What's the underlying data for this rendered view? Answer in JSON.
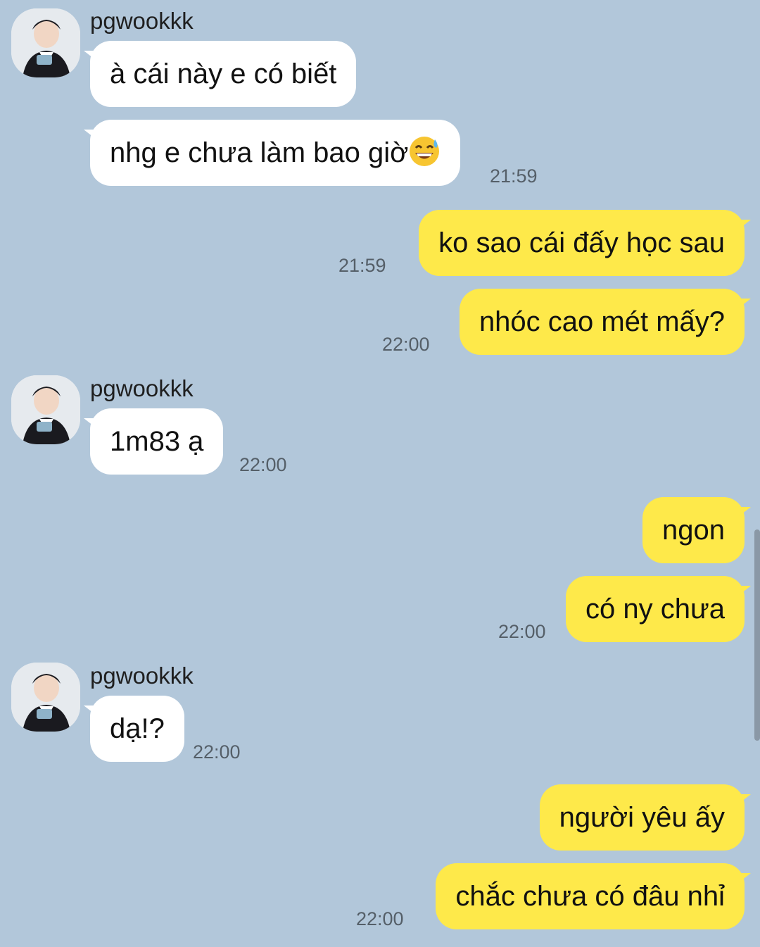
{
  "contact": {
    "name": "pgwookkk"
  },
  "messages": [
    {
      "from": "them",
      "text": "à cái này e có biết",
      "time": ""
    },
    {
      "from": "them",
      "text": "nhg e chưa làm bao giờ",
      "emoji": "grinning-sweat-emoji",
      "time": "21:59"
    },
    {
      "from": "me",
      "text": "ko sao cái đấy học sau",
      "time": "21:59"
    },
    {
      "from": "me",
      "text": "nhóc cao mét mấy?",
      "time": "22:00"
    },
    {
      "from": "them",
      "text": "1m83 ạ",
      "time": "22:00"
    },
    {
      "from": "me",
      "text": "ngon",
      "time": ""
    },
    {
      "from": "me",
      "text": "có ny chưa",
      "time": "22:00"
    },
    {
      "from": "them",
      "text": "dạ!?",
      "time": "22:00"
    },
    {
      "from": "me",
      "text": "người yêu ấy",
      "time": ""
    },
    {
      "from": "me",
      "text": "chắc chưa có đâu nhỉ",
      "time": "22:00"
    }
  ],
  "colors": {
    "background": "#b2c7da",
    "incoming": "#ffffff",
    "outgoing": "#fee94a"
  }
}
